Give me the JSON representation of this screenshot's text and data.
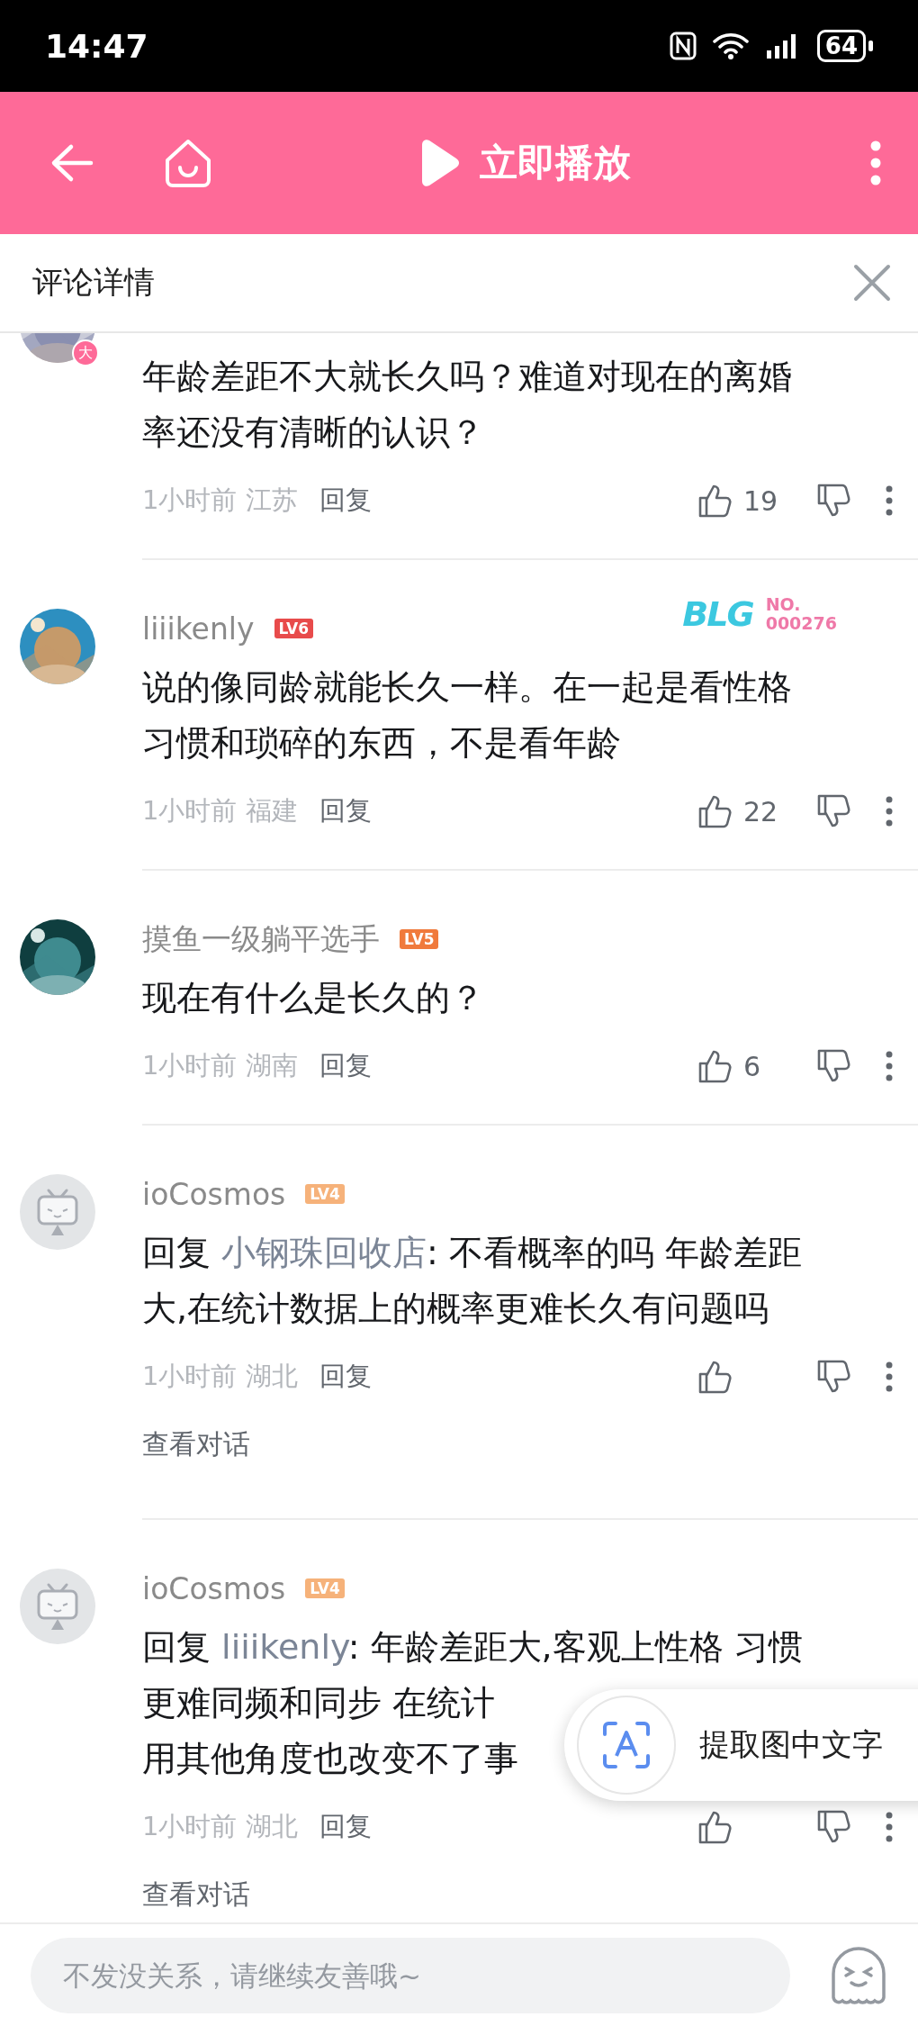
{
  "status_bar": {
    "time": "14:47",
    "battery": "64"
  },
  "header": {
    "play_label": "立即播放"
  },
  "panel": {
    "title": "评论详情"
  },
  "comments": [
    {
      "kind": "picture",
      "avatar_badge": "大",
      "lines": [
        "年龄差距不大就长久吗？难道对现在的离婚",
        "率还没有清晰的认识？"
      ],
      "time": "1小时前",
      "region": "江苏",
      "reply_label": "回复",
      "likes": "19"
    },
    {
      "kind": "picture",
      "user": "liiikenly",
      "level": "LV6",
      "color": "#e84b4b",
      "fan_badge": {
        "logo": "BLG",
        "no": "NO.",
        "number": "000276"
      },
      "lines": [
        "说的像同龄就能长久一样。在一起是看性格",
        "习惯和琐碎的东西，不是看年龄"
      ],
      "time": "1小时前",
      "region": "福建",
      "reply_label": "回复",
      "likes": "22"
    },
    {
      "kind": "picture",
      "user": "摸鱼一级躺平选手",
      "level": "LV5",
      "color": "#f07a3c",
      "lines": [
        "现在有什么是长久的？"
      ],
      "time": "1小时前",
      "region": "湖南",
      "reply_label": "回复",
      "likes": "6"
    },
    {
      "kind": "default",
      "user": "ioCosmos",
      "level": "LV4",
      "color": "#f6b27a",
      "reply_to": {
        "label": "回复",
        "user": "小钢珠回收店"
      },
      "lines": [
        ": 不看概率的吗 年龄差距",
        "大,在统计数据上的概率更难长久有问题吗"
      ],
      "time": "1小时前",
      "region": "湖北",
      "reply_label": "回复",
      "view_dialog": "查看对话"
    },
    {
      "kind": "default",
      "user": "ioCosmos",
      "level": "LV4",
      "color": "#f6b27a",
      "reply_to": {
        "label": "回复",
        "user": "liiikenly"
      },
      "lines": [
        ": 年龄差距大,客观上性格 习惯",
        "更难同频和同步 在统计",
        "用其他角度也改变不了事"
      ],
      "time": "1小时前",
      "region": "湖北",
      "reply_label": "回复",
      "view_dialog": "查看对话"
    }
  ],
  "ocr_popup": {
    "label": "提取图中文字"
  },
  "composer": {
    "placeholder": "不发没关系，请继续友善哦~"
  }
}
